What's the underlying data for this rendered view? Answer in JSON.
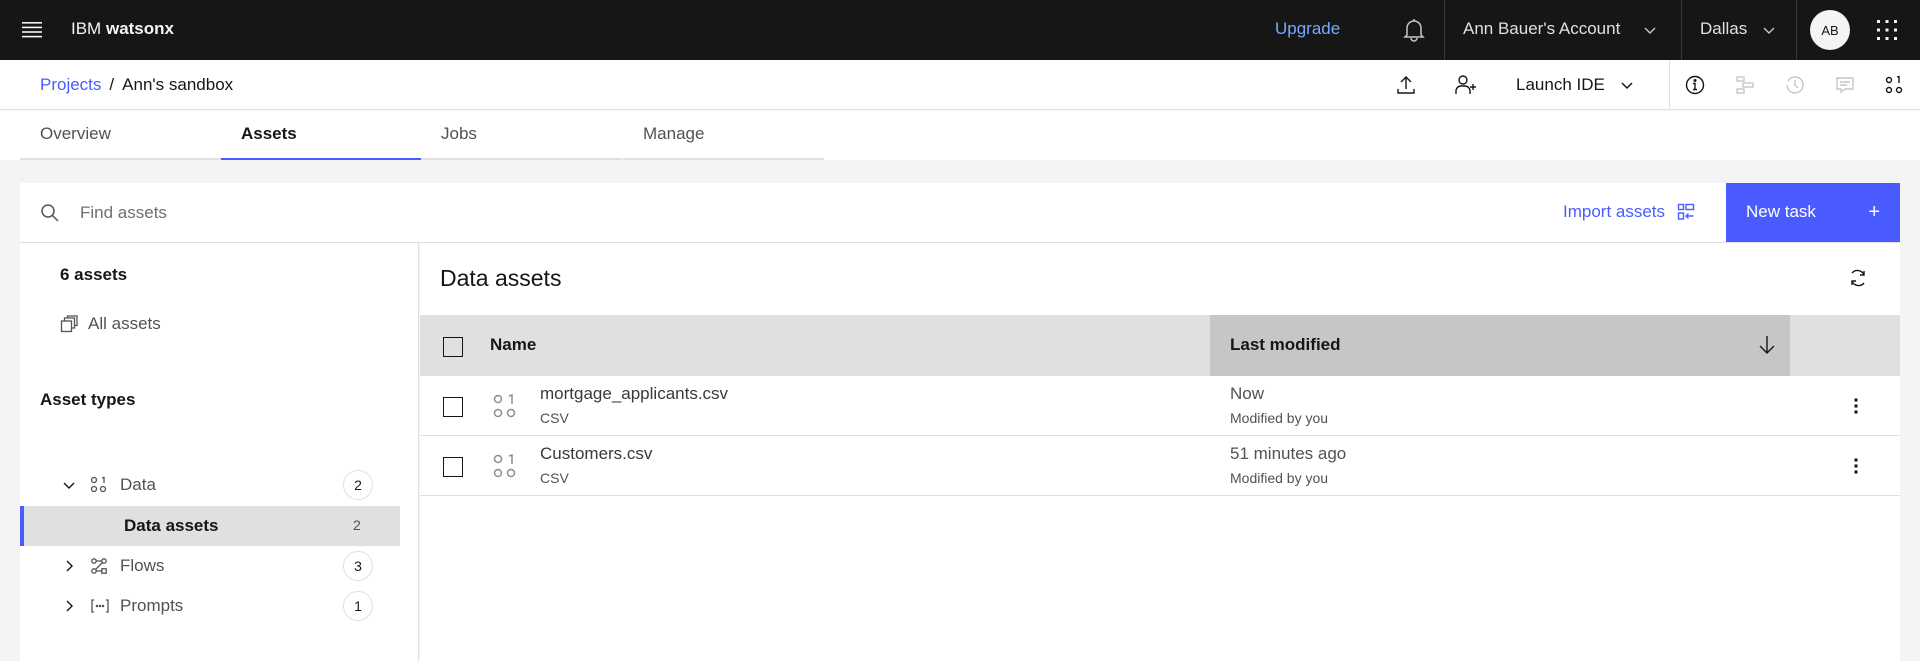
{
  "topbar": {
    "brand_prefix": "IBM",
    "brand_name": "watsonx",
    "upgrade": "Upgrade",
    "account": "Ann Bauer's Account",
    "region": "Dallas",
    "avatar_initials": "AB"
  },
  "breadcrumb": {
    "parent": "Projects",
    "separator": "/",
    "current": "Ann's sandbox"
  },
  "toolbar": {
    "launch_ide": "Launch IDE"
  },
  "tabs": [
    {
      "label": "Overview",
      "active": false
    },
    {
      "label": "Assets",
      "active": true
    },
    {
      "label": "Jobs",
      "active": false
    },
    {
      "label": "Manage",
      "active": false
    }
  ],
  "search": {
    "placeholder": "Find assets",
    "value": ""
  },
  "actions": {
    "import_assets": "Import assets",
    "new_task": "New task",
    "new_task_icon": "+"
  },
  "sidebar": {
    "asset_count": "6 assets",
    "all_assets": "All assets",
    "asset_types_heading": "Asset types",
    "tree": [
      {
        "label": "Data",
        "count": "2",
        "expanded": true,
        "icon": "data-icon"
      },
      {
        "label": "Data assets",
        "count": "2",
        "selected": true
      },
      {
        "label": "Flows",
        "count": "3",
        "expanded": false,
        "icon": "flows-icon"
      },
      {
        "label": "Prompts",
        "count": "1",
        "expanded": false,
        "icon": "prompts-icon"
      }
    ]
  },
  "main": {
    "title": "Data assets",
    "columns": {
      "name": "Name",
      "last_modified": "Last modified"
    },
    "rows": [
      {
        "name": "mortgage_applicants.csv",
        "type": "CSV",
        "modified": "Now",
        "modified_by": "Modified by you"
      },
      {
        "name": "Customers.csv",
        "type": "CSV",
        "modified": "51 minutes ago",
        "modified_by": "Modified by you"
      }
    ]
  },
  "colors": {
    "accent": "#4a5cff",
    "topbar_bg": "#161616",
    "upgrade_link": "#78a9ff"
  }
}
